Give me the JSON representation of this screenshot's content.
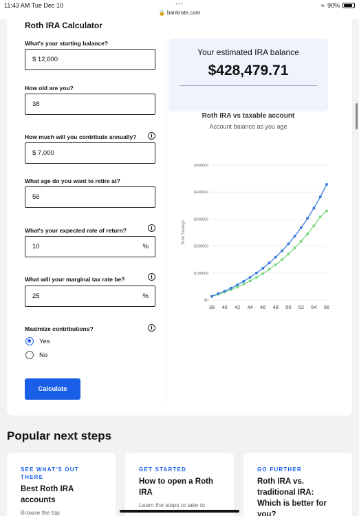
{
  "statusbar": {
    "time": "11:43 AM  Tue Dec 10",
    "dots": "•••",
    "url": "bankrate.com",
    "battery": "90%"
  },
  "calculator": {
    "title": "Roth IRA Calculator",
    "fields": {
      "starting_balance": {
        "label": "What's your starting balance?",
        "value": "$  12,600"
      },
      "age": {
        "label": "How old are you?",
        "value": "38"
      },
      "annual_contribution": {
        "label": "How much will you contribute annually?",
        "value": "$  7,000"
      },
      "retire_age": {
        "label": "What age do you want to retire at?",
        "value": "56"
      },
      "rate_of_return": {
        "label": "What's your expected rate of return?",
        "value": "10",
        "suffix": "%"
      },
      "tax_rate": {
        "label": "What will your marginal tax rate be?",
        "value": "25",
        "suffix": "%"
      }
    },
    "maximize": {
      "label": "Maximize contributions?",
      "options": [
        "Yes",
        "No"
      ],
      "selected": "Yes"
    },
    "button": "Calculate",
    "info_glyph": "i"
  },
  "result": {
    "label": "Your estimated IRA balance",
    "value": "$428,479.71"
  },
  "chart_data": {
    "type": "line",
    "title": "Roth IRA vs taxable account",
    "subtitle": "Account balance as you age",
    "xlabel": "",
    "ylabel": "Total Savings",
    "x": [
      38,
      39,
      40,
      41,
      42,
      43,
      44,
      45,
      46,
      47,
      48,
      49,
      50,
      51,
      52,
      53,
      54,
      55,
      56
    ],
    "xticks": [
      "38",
      "40",
      "42",
      "44",
      "46",
      "48",
      "50",
      "52",
      "54",
      "56"
    ],
    "yticks": [
      "$0",
      "$100000",
      "$200000",
      "$300000",
      "$400000",
      "$500000"
    ],
    "ylim": [
      0,
      500000
    ],
    "grid": true,
    "legend": "bottom",
    "series": [
      {
        "name": "Roth IRA",
        "color": "#3b7ddd",
        "values": [
          13860,
          22946,
          32940,
          43934,
          56028,
          69331,
          83964,
          100060,
          117766,
          137243,
          158667,
          182234,
          208157,
          236673,
          268040,
          302544,
          340499,
          382249,
          428480
        ]
      },
      {
        "name": "Taxable Account",
        "color": "#7dd87f",
        "values": [
          13545,
          21010,
          29184,
          38140,
          47967,
          58755,
          70599,
          83597,
          97850,
          113484,
          130634,
          149459,
          170154,
          192870,
          217799,
          245171,
          275213,
          308192,
          330400
        ]
      }
    ]
  },
  "popular": {
    "heading": "Popular next steps",
    "cards": [
      {
        "eyebrow": "SEE WHAT'S OUT THERE",
        "title": "Best Roth IRA accounts",
        "desc": "Browse the top"
      },
      {
        "eyebrow": "GET STARTED",
        "title": "How to open a Roth IRA",
        "desc": "Learn the steps to take to"
      },
      {
        "eyebrow": "GO FURTHER",
        "title": "Roth IRA vs. traditional IRA: Which is better for you?",
        "desc": ""
      }
    ]
  }
}
